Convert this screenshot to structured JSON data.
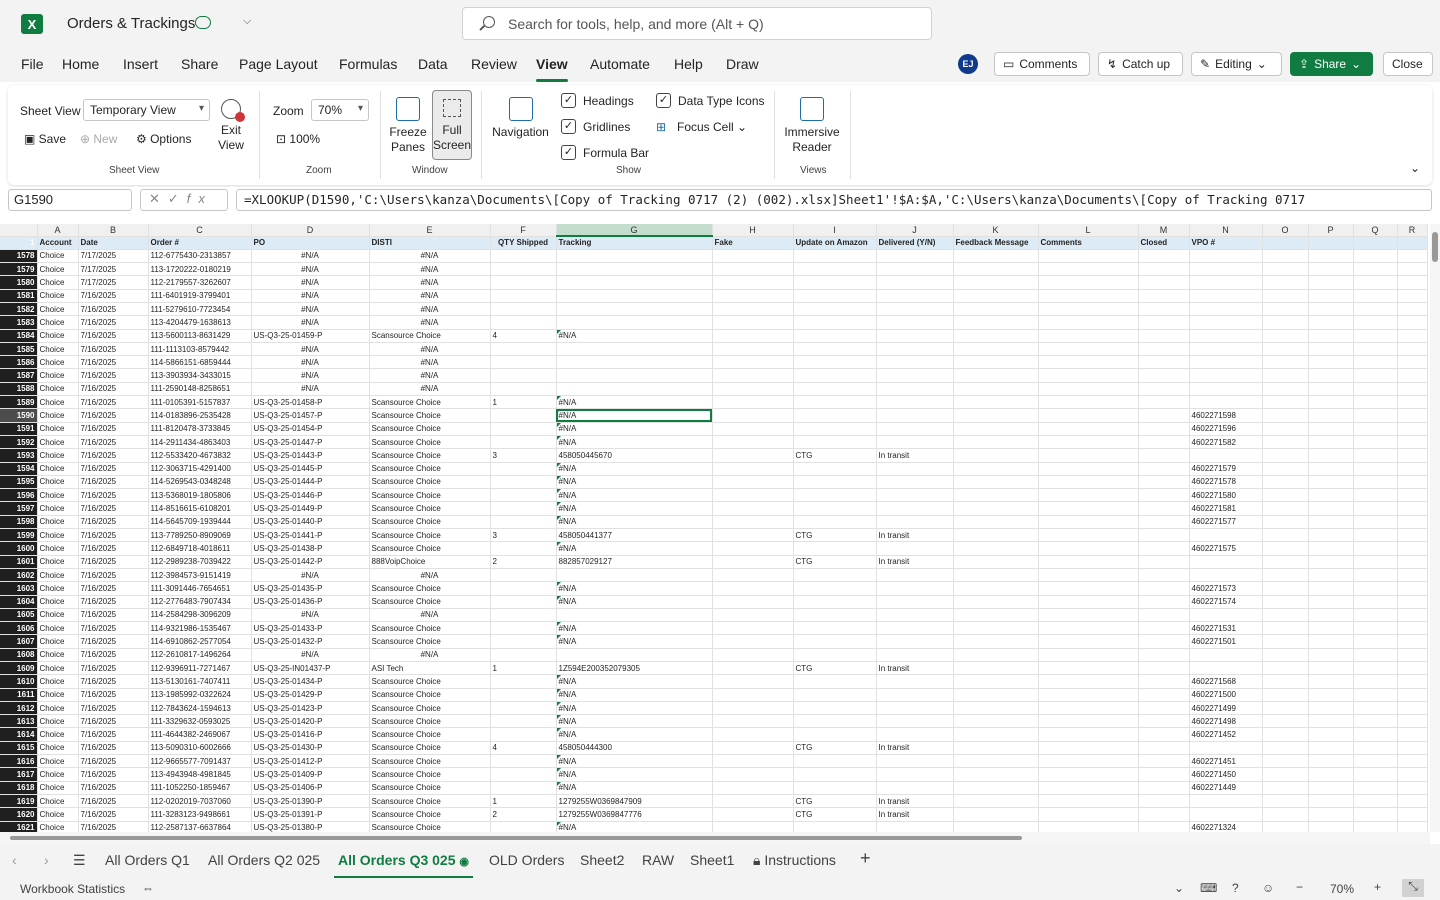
{
  "app": {
    "logo": "X",
    "title": "Orders & Trackings"
  },
  "search": {
    "placeholder": "Search for tools, help, and more (Alt + Q)"
  },
  "menu": [
    "File",
    "Home",
    "Insert",
    "Share",
    "Page Layout",
    "Formulas",
    "Data",
    "Review",
    "View",
    "Automate",
    "Help",
    "Draw"
  ],
  "menu_active": "View",
  "user": {
    "initials": "EJ"
  },
  "top_buttons": {
    "comments": "Comments",
    "catchup": "Catch up",
    "editing": "Editing",
    "share": "Share",
    "close": "Close"
  },
  "ribbon": {
    "sheet_view_label": "Sheet View",
    "sheet_view_value": "Temporary View",
    "save": "Save",
    "new": "New",
    "options": "Options",
    "exit_view": "Exit View",
    "group_sheet_view": "Sheet View",
    "zoom_label": "Zoom",
    "zoom_value": "70%",
    "zoom_100": "100%",
    "group_zoom": "Zoom",
    "freeze_panes": "Freeze Panes",
    "full_screen": "Full Screen",
    "group_window": "Window",
    "navigation": "Navigation",
    "headings": "Headings",
    "gridlines": "Gridlines",
    "formula_bar": "Formula Bar",
    "data_type_icons": "Data Type Icons",
    "focus_cell": "Focus Cell",
    "group_show": "Show",
    "immersive_reader": "Immersive Reader",
    "group_views": "Views"
  },
  "formula_bar": {
    "name_box": "G1590",
    "formula": "=XLOOKUP(D1590,'C:\\Users\\kanza\\Documents\\[Copy of Tracking 0717 (2) (002).xlsx]Sheet1'!$A:$A,'C:\\Users\\kanza\\Documents\\[Copy of Tracking 0717"
  },
  "columns": [
    "A",
    "B",
    "C",
    "D",
    "E",
    "F",
    "G",
    "H",
    "I",
    "J",
    "K",
    "L",
    "M",
    "N",
    "O",
    "P",
    "Q",
    "R"
  ],
  "header_row": {
    "num": "1",
    "cells": [
      "Account",
      "Date",
      "Order #",
      "PO",
      "DISTI",
      "QTY Shipped",
      "Tracking",
      "Fake",
      "Update on Amazon",
      "Delivered (Y/N)",
      "Feedback Message",
      "Comments",
      "Closed",
      "VPO #",
      "",
      "",
      "",
      ""
    ]
  },
  "rows": [
    {
      "n": "1578",
      "c": [
        "Choice",
        "7/17/2025",
        "112-6775430-2313857",
        "#N/A",
        "#N/A",
        "",
        "",
        "",
        "",
        "",
        "",
        "",
        "",
        "",
        "",
        "",
        "",
        ""
      ]
    },
    {
      "n": "1579",
      "c": [
        "Choice",
        "7/17/2025",
        "113-1720222-0180219",
        "#N/A",
        "#N/A",
        "",
        "",
        "",
        "",
        "",
        "",
        "",
        "",
        "",
        "",
        "",
        "",
        ""
      ]
    },
    {
      "n": "1580",
      "c": [
        "Choice",
        "7/17/2025",
        "112-2179557-3262607",
        "#N/A",
        "#N/A",
        "",
        "",
        "",
        "",
        "",
        "",
        "",
        "",
        "",
        "",
        "",
        "",
        ""
      ]
    },
    {
      "n": "1581",
      "c": [
        "Choice",
        "7/16/2025",
        "111-6401919-3799401",
        "#N/A",
        "#N/A",
        "",
        "",
        "",
        "",
        "",
        "",
        "",
        "",
        "",
        "",
        "",
        "",
        ""
      ]
    },
    {
      "n": "1582",
      "c": [
        "Choice",
        "7/16/2025",
        "111-5279610-7723454",
        "#N/A",
        "#N/A",
        "",
        "",
        "",
        "",
        "",
        "",
        "",
        "",
        "",
        "",
        "",
        "",
        ""
      ]
    },
    {
      "n": "1583",
      "c": [
        "Choice",
        "7/16/2025",
        "113-4204479-1638613",
        "#N/A",
        "#N/A",
        "",
        "",
        "",
        "",
        "",
        "",
        "",
        "",
        "",
        "",
        "",
        "",
        ""
      ]
    },
    {
      "n": "1584",
      "c": [
        "Choice",
        "7/16/2025",
        "113-5600113-8631429",
        "US-Q3-25-01459-P",
        "Scansource Choice",
        "4",
        "#N/A",
        "",
        "",
        "",
        "",
        "",
        "",
        "",
        "",
        "",
        "",
        ""
      ]
    },
    {
      "n": "1585",
      "c": [
        "Choice",
        "7/16/2025",
        "111-1113103-8579442",
        "#N/A",
        "#N/A",
        "",
        "",
        "",
        "",
        "",
        "",
        "",
        "",
        "",
        "",
        "",
        "",
        ""
      ]
    },
    {
      "n": "1586",
      "c": [
        "Choice",
        "7/16/2025",
        "114-5866151-6859444",
        "#N/A",
        "#N/A",
        "",
        "",
        "",
        "",
        "",
        "",
        "",
        "",
        "",
        "",
        "",
        "",
        ""
      ]
    },
    {
      "n": "1587",
      "c": [
        "Choice",
        "7/16/2025",
        "113-3903934-3433015",
        "#N/A",
        "#N/A",
        "",
        "",
        "",
        "",
        "",
        "",
        "",
        "",
        "",
        "",
        "",
        "",
        ""
      ]
    },
    {
      "n": "1588",
      "c": [
        "Choice",
        "7/16/2025",
        "111-2590148-8258651",
        "#N/A",
        "#N/A",
        "",
        "",
        "",
        "",
        "",
        "",
        "",
        "",
        "",
        "",
        "",
        "",
        ""
      ]
    },
    {
      "n": "1589",
      "c": [
        "Choice",
        "7/16/2025",
        "111-0105391-5157837",
        "US-Q3-25-01458-P",
        "Scansource Choice",
        "1",
        "#N/A",
        "",
        "",
        "",
        "",
        "",
        "",
        "",
        "",
        "",
        "",
        ""
      ]
    },
    {
      "n": "1590",
      "c": [
        "Choice",
        "7/16/2025",
        "114-0183896-2535428",
        "US-Q3-25-01457-P",
        "Scansource Choice",
        "",
        "#N/A",
        "",
        "",
        "",
        "",
        "",
        "",
        "4602271598",
        "",
        "",
        "",
        ""
      ]
    },
    {
      "n": "1591",
      "c": [
        "Choice",
        "7/16/2025",
        "111-8120478-3733845",
        "US-Q3-25-01454-P",
        "Scansource Choice",
        "",
        "#N/A",
        "",
        "",
        "",
        "",
        "",
        "",
        "4602271596",
        "",
        "",
        "",
        ""
      ]
    },
    {
      "n": "1592",
      "c": [
        "Choice",
        "7/16/2025",
        "114-2911434-4863403",
        "US-Q3-25-01447-P",
        "Scansource Choice",
        "",
        "#N/A",
        "",
        "",
        "",
        "",
        "",
        "",
        "4602271582",
        "",
        "",
        "",
        ""
      ]
    },
    {
      "n": "1593",
      "c": [
        "Choice",
        "7/16/2025",
        "112-5533420-4673832",
        "US-Q3-25-01443-P",
        "Scansource Choice",
        "3",
        "458050445670",
        "",
        "CTG",
        "In transit",
        "",
        "",
        "",
        "",
        "",
        "",
        "",
        ""
      ]
    },
    {
      "n": "1594",
      "c": [
        "Choice",
        "7/16/2025",
        "112-3063715-4291400",
        "US-Q3-25-01445-P",
        "Scansource Choice",
        "",
        "#N/A",
        "",
        "",
        "",
        "",
        "",
        "",
        "4602271579",
        "",
        "",
        "",
        ""
      ]
    },
    {
      "n": "1595",
      "c": [
        "Choice",
        "7/16/2025",
        "114-5269543-0348248",
        "US-Q3-25-01444-P",
        "Scansource Choice",
        "",
        "#N/A",
        "",
        "",
        "",
        "",
        "",
        "",
        "4602271578",
        "",
        "",
        "",
        ""
      ]
    },
    {
      "n": "1596",
      "c": [
        "Choice",
        "7/16/2025",
        "113-5368019-1805806",
        "US-Q3-25-01446-P",
        "Scansource Choice",
        "",
        "#N/A",
        "",
        "",
        "",
        "",
        "",
        "",
        "4602271580",
        "",
        "",
        "",
        ""
      ]
    },
    {
      "n": "1597",
      "c": [
        "Choice",
        "7/16/2025",
        "114-8516615-6108201",
        "US-Q3-25-01449-P",
        "Scansource Choice",
        "",
        "#N/A",
        "",
        "",
        "",
        "",
        "",
        "",
        "4602271581",
        "",
        "",
        "",
        ""
      ]
    },
    {
      "n": "1598",
      "c": [
        "Choice",
        "7/16/2025",
        "114-5645709-1939444",
        "US-Q3-25-01440-P",
        "Scansource Choice",
        "",
        "#N/A",
        "",
        "",
        "",
        "",
        "",
        "",
        "4602271577",
        "",
        "",
        "",
        ""
      ]
    },
    {
      "n": "1599",
      "c": [
        "Choice",
        "7/16/2025",
        "113-7789250-8909069",
        "US-Q3-25-01441-P",
        "Scansource Choice",
        "3",
        "458050441377",
        "",
        "CTG",
        "In transit",
        "",
        "",
        "",
        "",
        "",
        "",
        "",
        ""
      ]
    },
    {
      "n": "1600",
      "c": [
        "Choice",
        "7/16/2025",
        "112-6849718-4018611",
        "US-Q3-25-01438-P",
        "Scansource Choice",
        "",
        "#N/A",
        "",
        "",
        "",
        "",
        "",
        "",
        "4602271575",
        "",
        "",
        "",
        ""
      ]
    },
    {
      "n": "1601",
      "c": [
        "Choice",
        "7/16/2025",
        "112-2989238-7039422",
        "US-Q3-25-01442-P",
        "888VoipChoice",
        "2",
        "882857029127",
        "",
        "CTG",
        "In transit",
        "",
        "",
        "",
        "",
        "",
        "",
        "",
        ""
      ]
    },
    {
      "n": "1602",
      "c": [
        "Choice",
        "7/16/2025",
        "112-3984573-9151419",
        "#N/A",
        "#N/A",
        "",
        "",
        "",
        "",
        "",
        "",
        "",
        "",
        "",
        "",
        "",
        "",
        ""
      ]
    },
    {
      "n": "1603",
      "c": [
        "Choice",
        "7/16/2025",
        "111-3091446-7654651",
        "US-Q3-25-01435-P",
        "Scansource Choice",
        "",
        "#N/A",
        "",
        "",
        "",
        "",
        "",
        "",
        "4602271573",
        "",
        "",
        "",
        ""
      ]
    },
    {
      "n": "1604",
      "c": [
        "Choice",
        "7/16/2025",
        "112-2776483-7907434",
        "US-Q3-25-01436-P",
        "Scansource Choice",
        "",
        "#N/A",
        "",
        "",
        "",
        "",
        "",
        "",
        "4602271574",
        "",
        "",
        "",
        ""
      ]
    },
    {
      "n": "1605",
      "c": [
        "Choice",
        "7/16/2025",
        "114-2584298-3096209",
        "#N/A",
        "#N/A",
        "",
        "",
        "",
        "",
        "",
        "",
        "",
        "",
        "",
        "",
        "",
        "",
        ""
      ]
    },
    {
      "n": "1606",
      "c": [
        "Choice",
        "7/16/2025",
        "114-9321986-1535467",
        "US-Q3-25-01433-P",
        "Scansource Choice",
        "",
        "#N/A",
        "",
        "",
        "",
        "",
        "",
        "",
        "4602271531",
        "",
        "",
        "",
        ""
      ]
    },
    {
      "n": "1607",
      "c": [
        "Choice",
        "7/16/2025",
        "114-6910862-2577054",
        "US-Q3-25-01432-P",
        "Scansource Choice",
        "",
        "#N/A",
        "",
        "",
        "",
        "",
        "",
        "",
        "4602271501",
        "",
        "",
        "",
        ""
      ]
    },
    {
      "n": "1608",
      "c": [
        "Choice",
        "7/16/2025",
        "112-2610817-1496264",
        "#N/A",
        "#N/A",
        "",
        "",
        "",
        "",
        "",
        "",
        "",
        "",
        "",
        "",
        "",
        "",
        ""
      ]
    },
    {
      "n": "1609",
      "c": [
        "Choice",
        "7/16/2025",
        "112-9396911-7271467",
        "US-Q3-25-IN01437-P",
        "ASI Tech",
        "1",
        "1Z594E200352079305",
        "",
        "CTG",
        "In transit",
        "",
        "",
        "",
        "",
        "",
        "",
        "",
        ""
      ]
    },
    {
      "n": "1610",
      "c": [
        "Choice",
        "7/16/2025",
        "113-5130161-7407411",
        "US-Q3-25-01434-P",
        "Scansource Choice",
        "",
        "#N/A",
        "",
        "",
        "",
        "",
        "",
        "",
        "4602271568",
        "",
        "",
        "",
        ""
      ]
    },
    {
      "n": "1611",
      "c": [
        "Choice",
        "7/16/2025",
        "113-1985992-0322624",
        "US-Q3-25-01429-P",
        "Scansource Choice",
        "",
        "#N/A",
        "",
        "",
        "",
        "",
        "",
        "",
        "4602271500",
        "",
        "",
        "",
        ""
      ]
    },
    {
      "n": "1612",
      "c": [
        "Choice",
        "7/16/2025",
        "112-7843624-1594613",
        "US-Q3-25-01423-P",
        "Scansource Choice",
        "",
        "#N/A",
        "",
        "",
        "",
        "",
        "",
        "",
        "4602271499",
        "",
        "",
        "",
        ""
      ]
    },
    {
      "n": "1613",
      "c": [
        "Choice",
        "7/16/2025",
        "111-3329632-0593025",
        "US-Q3-25-01420-P",
        "Scansource Choice",
        "",
        "#N/A",
        "",
        "",
        "",
        "",
        "",
        "",
        "4602271498",
        "",
        "",
        "",
        ""
      ]
    },
    {
      "n": "1614",
      "c": [
        "Choice",
        "7/16/2025",
        "111-4644382-2469067",
        "US-Q3-25-01416-P",
        "Scansource Choice",
        "",
        "#N/A",
        "",
        "",
        "",
        "",
        "",
        "",
        "4602271452",
        "",
        "",
        "",
        ""
      ]
    },
    {
      "n": "1615",
      "c": [
        "Choice",
        "7/16/2025",
        "113-5090310-6002666",
        "US-Q3-25-01430-P",
        "Scansource Choice",
        "4",
        "458050444300",
        "",
        "CTG",
        "In transit",
        "",
        "",
        "",
        "",
        "",
        "",
        "",
        ""
      ]
    },
    {
      "n": "1616",
      "c": [
        "Choice",
        "7/16/2025",
        "112-9665577-7091437",
        "US-Q3-25-01412-P",
        "Scansource Choice",
        "",
        "#N/A",
        "",
        "",
        "",
        "",
        "",
        "",
        "4602271451",
        "",
        "",
        "",
        ""
      ]
    },
    {
      "n": "1617",
      "c": [
        "Choice",
        "7/16/2025",
        "113-4943948-4981845",
        "US-Q3-25-01409-P",
        "Scansource Choice",
        "",
        "#N/A",
        "",
        "",
        "",
        "",
        "",
        "",
        "4602271450",
        "",
        "",
        "",
        ""
      ]
    },
    {
      "n": "1618",
      "c": [
        "Choice",
        "7/16/2025",
        "111-1052250-1859467",
        "US-Q3-25-01406-P",
        "Scansource Choice",
        "",
        "#N/A",
        "",
        "",
        "",
        "",
        "",
        "",
        "4602271449",
        "",
        "",
        "",
        ""
      ]
    },
    {
      "n": "1619",
      "c": [
        "Choice",
        "7/16/2025",
        "112-0202019-7037060",
        "US-Q3-25-01390-P",
        "Scansource Choice",
        "1",
        "1279255W0369847909",
        "",
        "CTG",
        "In transit",
        "",
        "",
        "",
        "",
        "",
        "",
        "",
        ""
      ]
    },
    {
      "n": "1620",
      "c": [
        "Choice",
        "7/16/2025",
        "111-3283123-9498661",
        "US-Q3-25-01391-P",
        "Scansource Choice",
        "2",
        "1279255W0369847776",
        "",
        "CTG",
        "In transit",
        "",
        "",
        "",
        "",
        "",
        "",
        "",
        ""
      ]
    },
    {
      "n": "1621",
      "c": [
        "Choice",
        "7/16/2025",
        "112-2587137-6637864",
        "US-Q3-25-01380-P",
        "Scansource Choice",
        "",
        "#N/A",
        "",
        "",
        "",
        "",
        "",
        "",
        "4602271324",
        "",
        "",
        "",
        ""
      ]
    }
  ],
  "sheet_tabs": [
    "All Orders Q1",
    "All Orders Q2 025",
    "All Orders Q3 025",
    "OLD Orders",
    "Sheet2",
    "RAW",
    "Sheet1",
    "Instructions"
  ],
  "active_tab": "All Orders Q3 025",
  "status": {
    "workbook_stats": "Workbook Statistics",
    "zoom": "70%"
  }
}
